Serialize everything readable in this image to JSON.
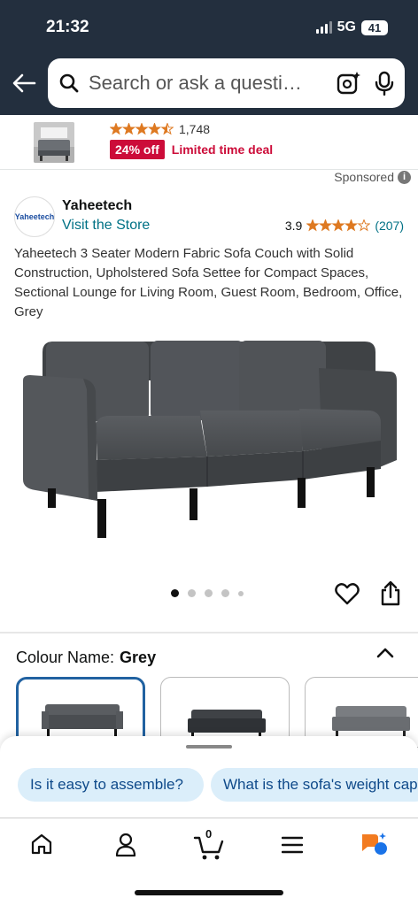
{
  "status_bar": {
    "time": "21:32",
    "network": "5G",
    "battery": "41"
  },
  "search": {
    "placeholder": "Search or ask a questi…"
  },
  "ad": {
    "rating_count": "1,748",
    "discount": "24% off",
    "deal_label": "Limited time deal",
    "sponsored": "Sponsored",
    "stars": 4.5
  },
  "product": {
    "brand_logo": "Yaheetech",
    "brand": "Yaheetech",
    "store_link": "Visit the Store",
    "rating": "3.9",
    "stars": 3.9,
    "rating_count": "(207)",
    "title": "Yaheetech 3 Seater Modern Fabric Sofa Couch with Solid Construction, Upholstered Sofa Settee for Compact Spaces, Sectional Lounge for Living Room, Guest Room, Bedroom, Office, Grey",
    "image_index": 1,
    "image_count": 5
  },
  "colour": {
    "label": "Colour Name:",
    "value": "Grey"
  },
  "suggestions": [
    "Is it easy to assemble?",
    "What is the sofa's weight capacity?"
  ],
  "cart": {
    "count": "0"
  },
  "colors": {
    "header": "#232f3e",
    "link": "#007185",
    "deal": "#cc0c39",
    "star": "#de7921",
    "selected": "#2162a1",
    "chip": "#dbeefa"
  },
  "icons": [
    "back-arrow-icon",
    "search-icon",
    "camera-lens-icon",
    "mic-icon",
    "info-icon",
    "heart-icon",
    "share-icon",
    "chevron-up-icon",
    "home-icon",
    "account-icon",
    "cart-icon",
    "menu-icon",
    "rufus-icon"
  ]
}
